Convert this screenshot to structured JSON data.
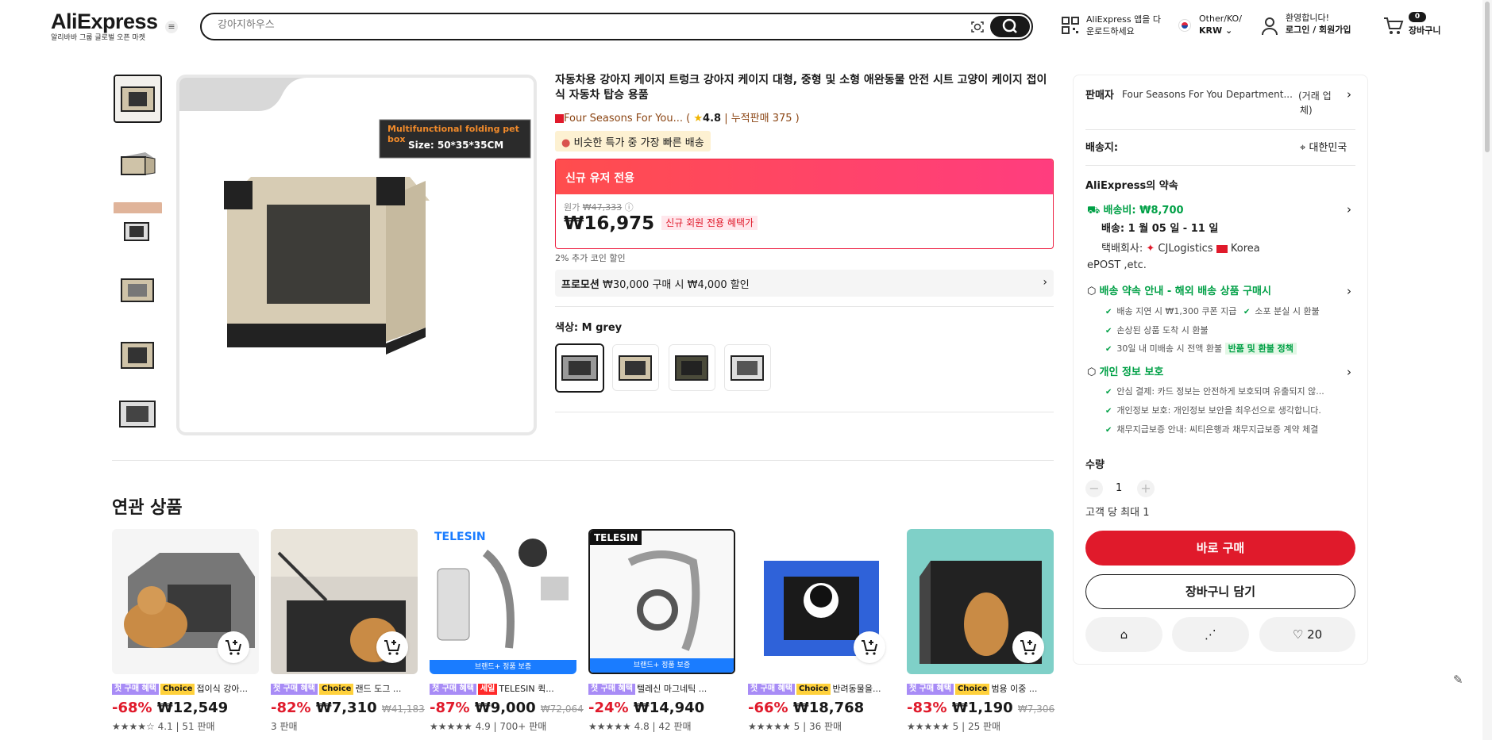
{
  "header": {
    "logo": "AliExpress",
    "logo_sub": "알리바바 그룹 글로벌 오픈 마켓",
    "search_placeholder": "강아지하우스",
    "app_line1": "AliExpress 앱을 다",
    "app_line2": "운로드하세요",
    "region_line1": "Other/KO/",
    "region_line2": "KRW",
    "account_line1": "환영합니다!",
    "account_line2": "로그인 / 회원가입",
    "cart_count": "0",
    "cart_label": "장바구니"
  },
  "gallery": {
    "main_banner_line1": "Multifunctional folding pet box",
    "main_banner_line2": "Size:   50*35*35CM"
  },
  "product": {
    "title": "자동차용 강아지 케이지 트렁크 강아지 케이지 대형, 중형 및 소형 애완동물 안전 시트 고양이 케이지 접이식 자동차 탑승 용품",
    "store": "Four Seasons For You...",
    "rating": "4.8",
    "sold": "누적판매 375",
    "fast_badge": "비슷한 특가 중 가장 빠른 배송",
    "price_head": "신규 유저 전용",
    "orig_label": "원가",
    "orig_price": "₩47,333",
    "price": "₩16,975",
    "price_tag": "신규 회원 전용 혜택가",
    "coin_note": "2% 추가 코인 할인",
    "promo_label": "프로모션",
    "promo_text": "₩30,000 구매 시 ₩4,000 할인",
    "color_label": "색상: M grey"
  },
  "panel": {
    "seller_label": "판매자",
    "seller_name": "Four Seasons For You Department...",
    "seller_type_1": "(거래 업",
    "seller_type_2": "체)",
    "ship_to_label": "배송지:",
    "ship_to": "대한민국",
    "promise_title": "AliExpress의 약속",
    "shipping_fee": "배송비: ₩8,700",
    "delivery": "배송: 1 월 05 일 - 11 일",
    "carrier_label": "택배회사:",
    "carrier1": "CJLogistics",
    "carrier2": "Korea",
    "carrier3": "ePOST ,etc.",
    "guarantee_title": "배송 약속 안내 - 해외 배송 상품 구매시",
    "g1": "배송 지연 시 ₩1,300 쿠폰 지급",
    "g2": "소포 분실 시 환불",
    "g3": "손상된 상품 도착 시 환불",
    "g4": "30일 내 미배송 시 전액 환불",
    "g4_badge": "반품 및 환불 정책",
    "privacy_title": "개인 정보 보호",
    "p1": "안심 결제: 카드 정보는 안전하게 보호되며 유출되지 않...",
    "p2": "개인정보 보호: 개인정보 보안을 최우선으로 생각합니다.",
    "p3": "채무지급보증 안내: 씨티은행과 채무지급보증 계약 체결",
    "qty_label": "수량",
    "qty_value": "1",
    "qty_limit": "고객 당 최대 1",
    "buy_now": "바로 구매",
    "add_cart": "장바구니 담기",
    "wish_count": "20"
  },
  "related": {
    "title": "연관 상품",
    "items": [
      {
        "tag1": "첫 구매 혜택",
        "tag2": "Choice",
        "name": "접이식 강아...",
        "disc": "-68%",
        "price": "₩12,549",
        "orig": "",
        "rating": "4.1",
        "sold": "51 판매"
      },
      {
        "tag1": "첫 구매 혜택",
        "tag2": "Choice",
        "name": "랜드 도그 ...",
        "disc": "-82%",
        "price": "₩7,310",
        "orig": "₩41,183",
        "rating": "",
        "sold": "3 판매"
      },
      {
        "tag1": "첫 구매 혜택",
        "tag2": "세일",
        "name": "TELESIN 퀵...",
        "disc": "-87%",
        "price": "₩9,000",
        "orig": "₩72,064",
        "rating": "4.9",
        "sold": "700+ 판매",
        "brand": "TELESIN",
        "strip": "브랜드+ 정품 보증"
      },
      {
        "tag1": "첫 구매 혜택",
        "tag2": "",
        "name": "텔레신 마그네틱 ...",
        "disc": "-24%",
        "price": "₩14,940",
        "orig": "",
        "rating": "4.8",
        "sold": "42 판매",
        "brand": "TELESIN",
        "strip": "브랜드+ 정품 보증"
      },
      {
        "tag1": "첫 구매 혜택",
        "tag2": "Choice",
        "name": "반려동물을...",
        "disc": "-66%",
        "price": "₩18,768",
        "orig": "",
        "rating": "5",
        "sold": "36 판매"
      },
      {
        "tag1": "첫 구매 혜택",
        "tag2": "Choice",
        "name": "범용 이중 ...",
        "disc": "-83%",
        "price": "₩1,190",
        "orig": "₩7,306",
        "rating": "5",
        "sold": "25 판매"
      }
    ]
  }
}
